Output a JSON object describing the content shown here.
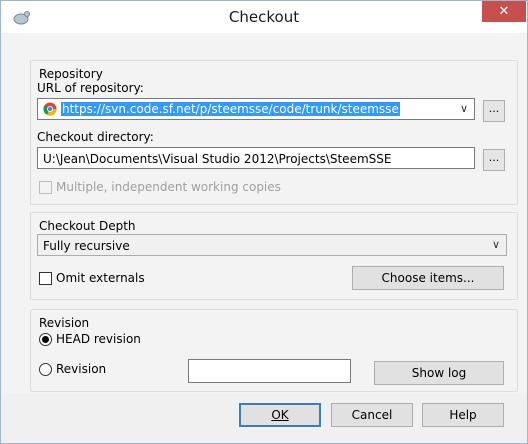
{
  "window": {
    "title": "Checkout",
    "close_glyph": "✕"
  },
  "repository": {
    "group_label": "Repository",
    "url_label": "URL of repository:",
    "url_value": "https://svn.code.sf.net/p/steemsse/code/trunk/steemsse",
    "browse_label": "...",
    "checkout_dir_label": "Checkout directory:",
    "checkout_dir_value": "U:\\Jean\\Documents\\Visual Studio 2012\\Projects\\SteemSSE",
    "browse_dir_label": "...",
    "multiple_copies_label": "Multiple, independent working copies"
  },
  "depth": {
    "group_label": "Checkout Depth",
    "selected": "Fully recursive",
    "omit_externals_label": "Omit externals",
    "choose_items_label": "Choose items..."
  },
  "revision": {
    "group_label": "Revision",
    "head_label": "HEAD revision",
    "revision_label": "Revision",
    "revision_value": "",
    "show_log_label": "Show log"
  },
  "footer": {
    "ok_label": "OK",
    "cancel_label": "Cancel",
    "help_label": "Help"
  },
  "colors": {
    "close": "#c7504d",
    "selection": "#3399ff"
  }
}
